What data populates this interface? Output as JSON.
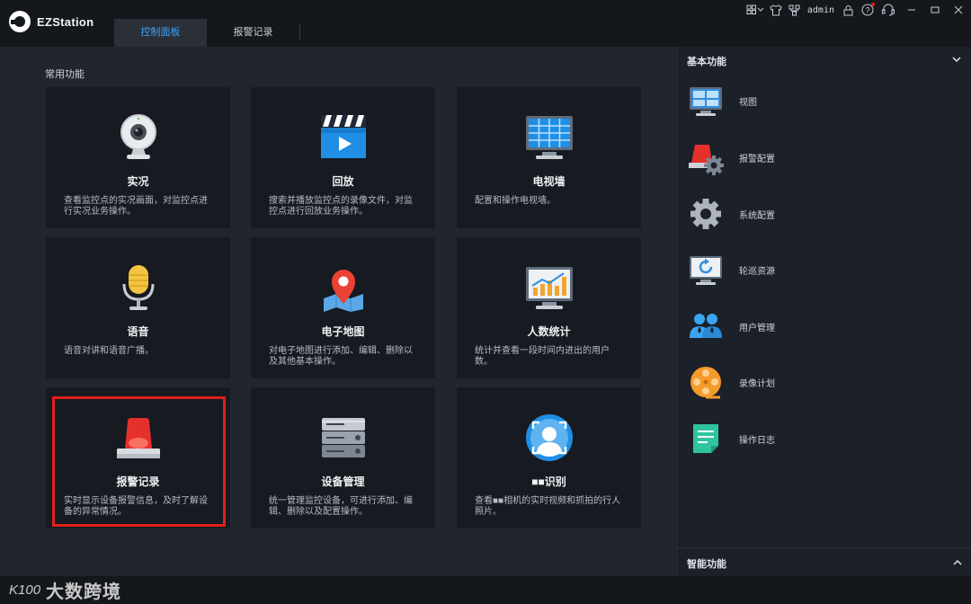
{
  "app": {
    "name": "EZStation"
  },
  "tabs": [
    {
      "label": "控制面板",
      "active": true
    },
    {
      "label": "报警记录",
      "active": false
    }
  ],
  "titlebar": {
    "user": "admin",
    "icons": [
      "layout-icon",
      "shirt-icon",
      "network-icon",
      "lock-icon",
      "help-icon",
      "support-icon",
      "minimize-icon",
      "maximize-icon",
      "close-icon"
    ]
  },
  "main": {
    "section_title": "常用功能",
    "cards": [
      {
        "title": "实况",
        "desc": "查看监控点的实况画面，对监控点进行实况业务操作。",
        "icon": "webcam-icon"
      },
      {
        "title": "回放",
        "desc": "搜索并播放监控点的录像文件，对监控点进行回放业务操作。",
        "icon": "clapper-icon"
      },
      {
        "title": "电视墙",
        "desc": "配置和操作电视墙。",
        "icon": "tv-wall-icon"
      },
      {
        "title": "语音",
        "desc": "语音对讲和语音广播。",
        "icon": "microphone-icon"
      },
      {
        "title": "电子地图",
        "desc": "对电子地图进行添加、编辑、删除以及其他基本操作。",
        "icon": "map-pin-icon"
      },
      {
        "title": "人数统计",
        "desc": "统计并查看一段时间内进出的用户数。",
        "icon": "chart-monitor-icon"
      },
      {
        "title": "报警记录",
        "desc": "实时显示设备报警信息，及时了解设备的异常情况。",
        "icon": "alarm-light-icon",
        "highlighted": true
      },
      {
        "title": "设备管理",
        "desc": "统一管理监控设备，可进行添加、编辑、删除以及配置操作。",
        "icon": "server-icon"
      },
      {
        "title": "■■识别",
        "desc": "查看■■相机的实时视频和抓拍的行人照片。",
        "icon": "face-recognition-icon"
      }
    ]
  },
  "side": {
    "header": "基本功能",
    "items": [
      {
        "label": "视图",
        "icon": "view-monitor-icon"
      },
      {
        "label": "报警配置",
        "icon": "alarm-config-icon"
      },
      {
        "label": "系统配置",
        "icon": "gear-icon"
      },
      {
        "label": "轮巡资源",
        "icon": "patrol-monitor-icon"
      },
      {
        "label": "用户管理",
        "icon": "users-icon"
      },
      {
        "label": "录像计划",
        "icon": "film-reel-icon"
      },
      {
        "label": "操作日志",
        "icon": "log-document-icon"
      }
    ],
    "footer": "智能功能"
  },
  "watermark": {
    "mark": "K100",
    "text": "大数跨境"
  },
  "colors": {
    "accent": "#3da2f5",
    "highlight": "#e0201b",
    "background": "#21252d",
    "card": "#171a20"
  }
}
